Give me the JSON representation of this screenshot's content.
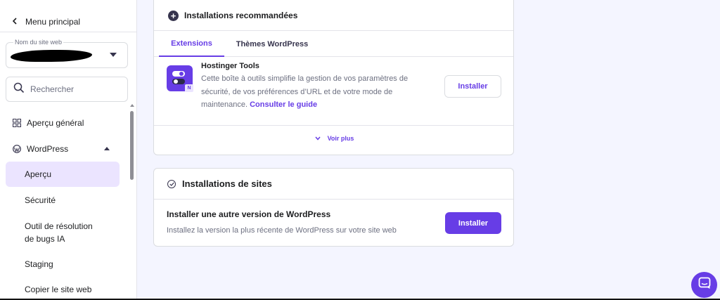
{
  "sidebar": {
    "back_label": "Menu principal",
    "site_select": {
      "label": "Nom du site web",
      "value": ""
    },
    "search_placeholder": "Rechercher",
    "items": [
      {
        "label": "Aperçu général",
        "icon": "grid-icon"
      },
      {
        "label": "WordPress",
        "icon": "wordpress-icon",
        "expanded": true
      },
      {
        "label": "Aperçu",
        "active": true
      },
      {
        "label": "Sécurité"
      },
      {
        "label": "Outil de résolution de bugs IA"
      },
      {
        "label": "Staging"
      },
      {
        "label": "Copier le site web"
      }
    ]
  },
  "recommended": {
    "title": "Installations recommandées",
    "tabs": [
      "Extensions",
      "Thèmes WordPress"
    ],
    "active_tab": "Extensions",
    "plugin": {
      "name": "Hostinger Tools",
      "logo_badge": "N",
      "description": "Cette boîte à outils simplifie la gestion de vos paramètres de sécurité, de vos préférences d’URL et de votre mode de maintenance.",
      "link": "Consulter le guide",
      "button": "Installer"
    },
    "see_more": "Voir plus"
  },
  "site_installs": {
    "title": "Installations de sites",
    "row_title": "Installer une autre version de WordPress",
    "row_desc": "Installez la version la plus récente de WordPress sur votre site web",
    "button": "Installer"
  },
  "colors": {
    "accent": "#673de6",
    "accent_light": "#ebe4ff",
    "background": "#f4f5ff",
    "text_dark": "#1d1e20",
    "text_muted": "#6d7081"
  }
}
